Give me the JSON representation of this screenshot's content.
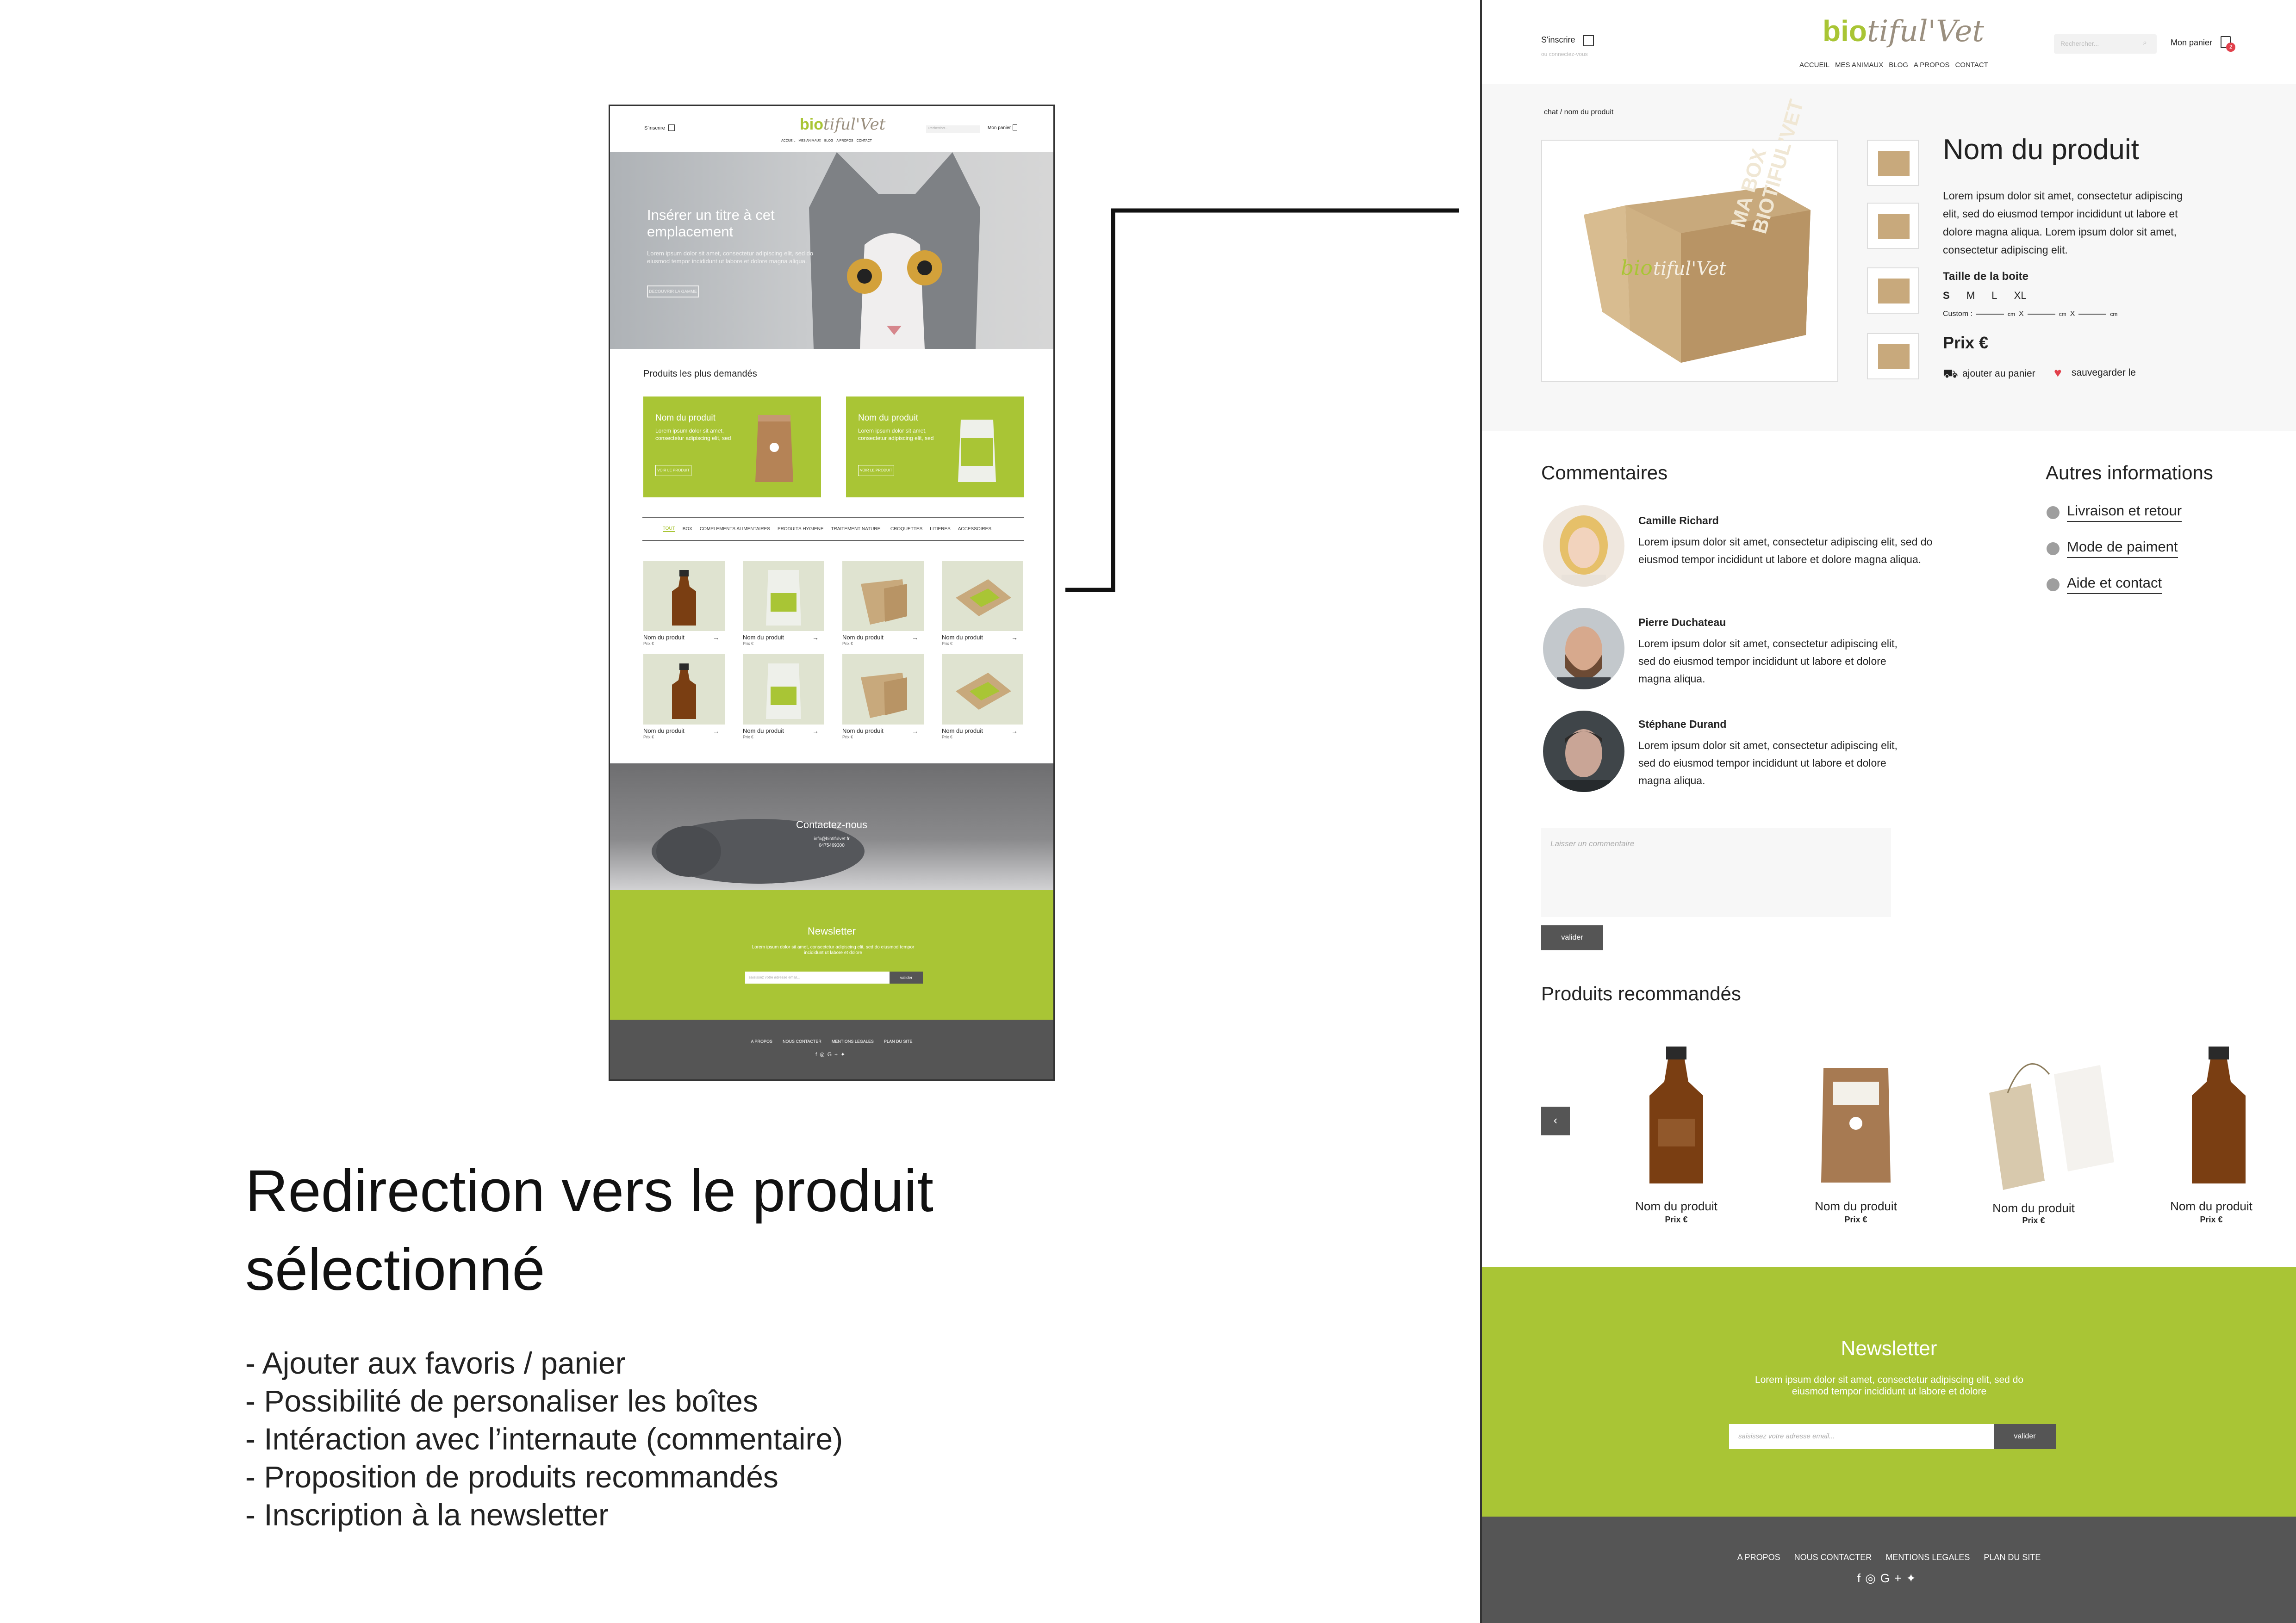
{
  "home": {
    "header": {
      "signup": "S'inscrire",
      "search_placeholder": "Rechercher...",
      "cart": "Mon panier",
      "nav": [
        "ACCUEIL",
        "MES ANIMAUX",
        "BLOG",
        "A PROPOS",
        "CONTACT"
      ]
    },
    "logo": {
      "bio": "bio",
      "rest": "tiful'Vet"
    },
    "hero": {
      "title": "Insérer un titre à cet emplacement",
      "text": "Lorem ipsum dolor sit amet, consectetur adipiscing elit, sed do eiusmod tempor incididunt ut labore et dolore magna aliqua.",
      "button": "DECOUVRIR LA GAMME"
    },
    "featured": {
      "title": "Produits les plus demandés",
      "cards": [
        {
          "name": "Nom du produit",
          "desc": "Lorem ipsum dolor sit amet, consectetur adipiscing elit, sed",
          "button": "VOIR LE PRODUIT"
        },
        {
          "name": "Nom du produit",
          "desc": "Lorem ipsum dolor sit amet, consectetur adipiscing elit, sed",
          "button": "VOIR LE PRODUIT"
        }
      ]
    },
    "tabs": [
      "TOUT",
      "BOX",
      "COMPLEMENTS ALIMENTAIRES",
      "PRODUITS HYGIENE",
      "TRAITEMENT NATUREL",
      "CROQUETTES",
      "LITIERES",
      "ACCESSOIRES"
    ],
    "products": [
      {
        "name": "Nom du produit",
        "price": "Prix €",
        "kind": "bottle"
      },
      {
        "name": "Nom du produit",
        "price": "Prix €",
        "kind": "pouch"
      },
      {
        "name": "Nom du produit",
        "price": "Prix €",
        "kind": "box"
      },
      {
        "name": "Nom du produit",
        "price": "Prix €",
        "kind": "openbox"
      },
      {
        "name": "Nom du produit",
        "price": "Prix €",
        "kind": "bottle"
      },
      {
        "name": "Nom du produit",
        "price": "Prix €",
        "kind": "pouch"
      },
      {
        "name": "Nom du produit",
        "price": "Prix €",
        "kind": "box"
      },
      {
        "name": "Nom du produit",
        "price": "Prix €",
        "kind": "openbox"
      }
    ],
    "contact": {
      "title": "Contactez-nous",
      "email": "info@biotifulvet.fr",
      "phone": "0475469300"
    },
    "newsletter": {
      "title": "Newsletter",
      "text": "Lorem ipsum dolor sit amet, consectetur adipiscing elit, sed do eiusmod tempor incididunt ut labore et dolore",
      "placeholder": "saisissez votre adresse email...",
      "button": "valider"
    },
    "footer": {
      "links": [
        "A PROPOS",
        "NOUS CONTACTER",
        "MENTIONS LEGALES",
        "PLAN DU SITE"
      ]
    }
  },
  "product_page": {
    "header": {
      "signup": "S'inscrire",
      "signup_sub": "ou connectez-vous",
      "search_placeholder": "Rechercher...",
      "cart": "Mon panier",
      "cart_count": "2",
      "nav": [
        "ACCUEIL",
        "MES ANIMAUX",
        "BLOG",
        "A PROPOS",
        "CONTACT"
      ]
    },
    "logo": {
      "bio": "bio",
      "rest": "tiful'Vet"
    },
    "breadcrumb": "chat / nom du produit",
    "product": {
      "box_text": "MA BOX BIOTIFUL'VET",
      "name": "Nom du produit",
      "description": "Lorem ipsum dolor sit amet, consectetur adipiscing elit, sed do eiusmod tempor incididunt ut labore et dolore magna aliqua. Lorem ipsum dolor sit amet, consectetur adipiscing elit.",
      "size_label": "Taille de la boite",
      "sizes": [
        "S",
        "M",
        "L",
        "XL"
      ],
      "selected_size": "S",
      "custom_label": "Custom :",
      "custom_unit": "cm",
      "custom_sep": "X",
      "price": "Prix €",
      "add_to_cart": "ajouter au panier",
      "save": "sauvegarder le"
    },
    "comments": {
      "title": "Commentaires",
      "items": [
        {
          "name": "Camille Richard",
          "text": "Lorem ipsum dolor sit amet, consectetur adipiscing elit, sed do eiusmod tempor incididunt ut labore et dolore magna aliqua."
        },
        {
          "name": "Pierre Duchateau",
          "text": "Lorem ipsum dolor sit amet, consectetur adipiscing elit, sed do eiusmod tempor incididunt ut labore et dolore magna aliqua."
        },
        {
          "name": "Stéphane Durand",
          "text": "Lorem ipsum dolor sit amet, consectetur adipiscing elit, sed do eiusmod tempor incididunt ut labore et dolore magna aliqua."
        }
      ],
      "placeholder": "Laisser un commentaire",
      "submit": "valider"
    },
    "other_info": {
      "title": "Autres informations",
      "items": [
        "Livraison et retour",
        "Mode de paiment",
        "Aide et contact"
      ]
    },
    "recommended": {
      "title": "Produits recommandés",
      "items": [
        {
          "name": "Nom du produit",
          "price": "Prix €"
        },
        {
          "name": "Nom du produit",
          "price": "Prix €"
        },
        {
          "name": "Nom du produit",
          "price": "Prix €"
        },
        {
          "name": "Nom du produit",
          "price": "Prix €"
        }
      ]
    },
    "newsletter": {
      "title": "Newsletter",
      "text": "Lorem ipsum dolor sit amet, consectetur adipiscing elit, sed do eiusmod tempor incididunt ut labore et dolore",
      "placeholder": "saisissez votre adresse email...",
      "button": "valider"
    },
    "footer": {
      "links": [
        "A PROPOS",
        "NOUS CONTACTER",
        "MENTIONS LEGALES",
        "PLAN DU SITE"
      ]
    }
  },
  "annotation": {
    "title": "Redirection vers le produit sélectionné",
    "points": [
      "- Ajouter aux favoris / panier",
      "- Possibilité de personaliser les boîtes",
      "- Intéraction avec l’internaute (commentaire)",
      "- Proposition de produits recommandés",
      "- Inscription à la newsletter"
    ]
  },
  "colors": {
    "accent": "#a9c535",
    "footer": "#555555",
    "heart": "#e2404b"
  }
}
